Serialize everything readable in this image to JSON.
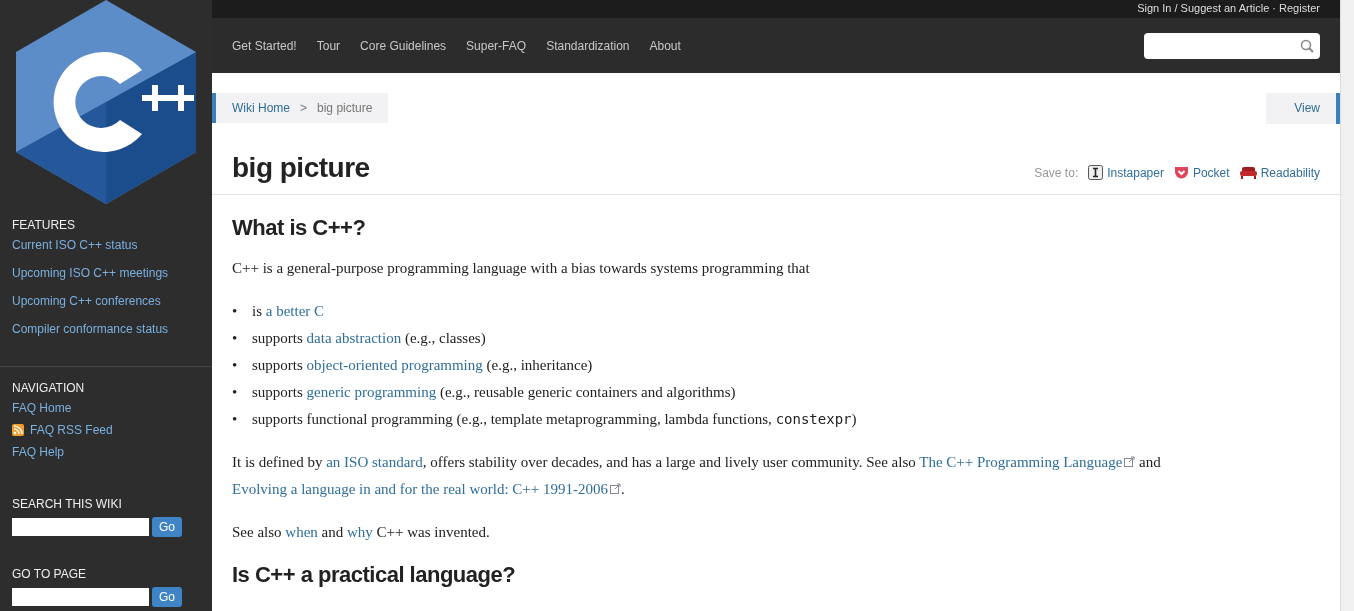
{
  "top_bar": {
    "account_links": "Sign In / Suggest an Article · Register"
  },
  "nav": {
    "items": [
      "Get Started!",
      "Tour",
      "Core Guidelines",
      "Super-FAQ",
      "Standardization",
      "About"
    ]
  },
  "sidebar": {
    "sections": [
      {
        "kind": "links",
        "heading": "FEATURES",
        "items": [
          {
            "label": "Current ISO C++ status"
          },
          {
            "label": "Upcoming ISO C++ meetings"
          },
          {
            "label": "Upcoming C++ conferences"
          },
          {
            "label": "Compiler conformance status"
          }
        ]
      },
      {
        "kind": "nav",
        "heading": "NAVIGATION",
        "items": [
          {
            "label": "FAQ Home",
            "kind": "link"
          },
          {
            "label": "FAQ RSS Feed",
            "kind": "feed"
          },
          {
            "label": "FAQ Help",
            "kind": "link"
          }
        ]
      },
      {
        "kind": "search",
        "heading": "SEARCH THIS WIKI",
        "button": "Go"
      },
      {
        "kind": "search",
        "heading": "GO TO PAGE",
        "button": "Go"
      }
    ]
  },
  "breadcrumb": {
    "items": [
      {
        "label": "Wiki Home",
        "kind": "link"
      },
      {
        "label": "big picture",
        "kind": "current"
      }
    ],
    "separator": ">"
  },
  "view_button": "View",
  "page": {
    "title": "big picture",
    "save_to": {
      "label": "Save to:",
      "services": [
        {
          "label": "Instapaper"
        },
        {
          "label": "Pocket"
        },
        {
          "label": "Readability"
        }
      ]
    }
  },
  "content": [
    {
      "kind": "heading",
      "text": "What is C++?"
    },
    {
      "kind": "paragraph",
      "segments": [
        {
          "kind": "text",
          "text": "C++ is a general-purpose programming language with a bias towards systems programming that"
        }
      ]
    },
    {
      "kind": "list",
      "bullet": "•",
      "items": [
        [
          {
            "kind": "text",
            "text": "is "
          },
          {
            "kind": "link",
            "text": "a better C"
          }
        ],
        [
          {
            "kind": "text",
            "text": "supports "
          },
          {
            "kind": "link",
            "text": "data abstraction"
          },
          {
            "kind": "text",
            "text": " (e.g., classes)"
          }
        ],
        [
          {
            "kind": "text",
            "text": "supports "
          },
          {
            "kind": "link",
            "text": "object-oriented programming"
          },
          {
            "kind": "text",
            "text": " (e.g., inheritance)"
          }
        ],
        [
          {
            "kind": "text",
            "text": "supports "
          },
          {
            "kind": "link",
            "text": "generic programming"
          },
          {
            "kind": "text",
            "text": " (e.g., reusable generic containers and algorithms)"
          }
        ],
        [
          {
            "kind": "text",
            "text": "supports functional programming (e.g., template metaprogramming, lambda functions, "
          },
          {
            "kind": "code",
            "text": "constexpr"
          },
          {
            "kind": "text",
            "text": ")"
          }
        ]
      ]
    },
    {
      "kind": "paragraph",
      "segments": [
        {
          "kind": "text",
          "text": "It is defined by "
        },
        {
          "kind": "link",
          "text": "an ISO standard"
        },
        {
          "kind": "text",
          "text": ", offers stability over decades, and has a large and lively user community. See also "
        },
        {
          "kind": "external",
          "text": "The C++ Programming Language"
        },
        {
          "kind": "text",
          "text": " and "
        },
        {
          "kind": "external",
          "text": "Evolving a language in and for the real world: C++ 1991-2006"
        },
        {
          "kind": "text",
          "text": "."
        }
      ]
    },
    {
      "kind": "paragraph",
      "segments": [
        {
          "kind": "text",
          "text": "See also "
        },
        {
          "kind": "link",
          "text": "when"
        },
        {
          "kind": "text",
          "text": " and "
        },
        {
          "kind": "link",
          "text": "why"
        },
        {
          "kind": "text",
          "text": " C++ was invented."
        }
      ]
    },
    {
      "kind": "heading",
      "text": "Is C++ a practical language?"
    }
  ]
}
